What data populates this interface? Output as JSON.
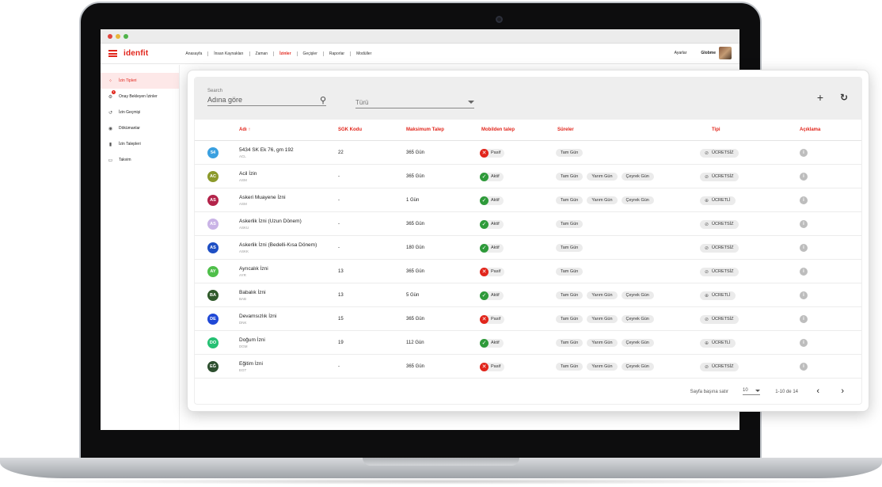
{
  "app": {
    "brand": "idenfit",
    "menu": [
      "Anasayfa",
      "İnsan Kaynakları",
      "Zaman",
      "İzinler",
      "Geçişler",
      "Raporlar",
      "Modüller"
    ],
    "active_menu_index": 3,
    "settings": "Ayarlar",
    "user": "Globme"
  },
  "sidebar": {
    "items": [
      {
        "label": "İzin Tipleri",
        "icon": "grid-icon",
        "active": true
      },
      {
        "label": "Onay Bekleyen İzinler",
        "icon": "pending-icon",
        "badge": "3"
      },
      {
        "label": "İzin Geçmişi",
        "icon": "history-icon"
      },
      {
        "label": "Dökümanlar",
        "icon": "documents-icon"
      },
      {
        "label": "İzin Talepleri",
        "icon": "requests-icon"
      },
      {
        "label": "Takvim",
        "icon": "calendar-icon"
      }
    ]
  },
  "filters": {
    "search_label": "Search",
    "search_placeholder": "Adına göre",
    "type_placeholder": "Türü"
  },
  "table": {
    "columns": {
      "name": "Adı ↑",
      "sgk": "SGK Kodu",
      "max": "Maksimum Talep",
      "mobile": "Mobilden talep",
      "durations": "Süreler",
      "type": "Tipi",
      "desc": "Açıklama"
    },
    "rows": [
      {
        "abbr": "54",
        "color": "#3aa0e0",
        "name": "5434 SK Ek 76, gm 192",
        "code": "ACL",
        "sgk": "22",
        "max": "365 Gün",
        "mobile": "Pasif",
        "active": false,
        "durations": [
          "Tam Gün"
        ],
        "type": "ÜCRETSİZ"
      },
      {
        "abbr": "AC",
        "color": "#8c9a2b",
        "name": "Acil İzin",
        "code": "ASM",
        "sgk": "-",
        "max": "365 Gün",
        "mobile": "Aktif",
        "active": true,
        "durations": [
          "Tam Gün",
          "Yarım Gün",
          "Çeyrek Gün"
        ],
        "type": "ÜCRETSİZ"
      },
      {
        "abbr": "AS",
        "color": "#b3234a",
        "name": "Askeri Muayene İzni",
        "code": "ASM",
        "sgk": "-",
        "max": "1 Gün",
        "mobile": "Aktif",
        "active": true,
        "durations": [
          "Tam Gün",
          "Yarım Gün",
          "Çeyrek Gün"
        ],
        "type": "ÜCRETLİ"
      },
      {
        "abbr": "AS",
        "color": "#c9b3e6",
        "name": "Askerlik İzni (Uzun Dönem)",
        "code": "ASKU",
        "sgk": "-",
        "max": "365 Gün",
        "mobile": "Aktif",
        "active": true,
        "durations": [
          "Tam Gün"
        ],
        "type": "ÜCRETSİZ"
      },
      {
        "abbr": "AS",
        "color": "#1e4fc4",
        "name": "Askerlik İzni (Bedelli-Kısa Dönem)",
        "code": "ASKK",
        "sgk": "-",
        "max": "180 Gün",
        "mobile": "Aktif",
        "active": true,
        "durations": [
          "Tam Gün"
        ],
        "type": "ÜCRETSİZ"
      },
      {
        "abbr": "AY",
        "color": "#4fbf4a",
        "name": "Ayrıcalık İzni",
        "code": "AYR",
        "sgk": "13",
        "max": "365 Gün",
        "mobile": "Pasif",
        "active": false,
        "durations": [
          "Tam Gün"
        ],
        "type": "ÜCRETSİZ"
      },
      {
        "abbr": "BA",
        "color": "#2f5a2a",
        "name": "Babalık İzni",
        "code": "BAB",
        "sgk": "13",
        "max": "5 Gün",
        "mobile": "Aktif",
        "active": true,
        "durations": [
          "Tam Gün",
          "Yarım Gün",
          "Çeyrek Gün"
        ],
        "type": "ÜCRETLİ"
      },
      {
        "abbr": "DE",
        "color": "#1f48d6",
        "name": "Devamsızlık İzni",
        "code": "DNK",
        "sgk": "15",
        "max": "365 Gün",
        "mobile": "Pasif",
        "active": false,
        "durations": [
          "Tam Gün",
          "Yarım Gün",
          "Çeyrek Gün"
        ],
        "type": "ÜCRETSİZ"
      },
      {
        "abbr": "DO",
        "color": "#25c073",
        "name": "Doğum İzni",
        "code": "DGM",
        "sgk": "19",
        "max": "112 Gün",
        "mobile": "Aktif",
        "active": true,
        "durations": [
          "Tam Gün",
          "Yarım Gün",
          "Çeyrek Gün"
        ],
        "type": "ÜCRETLİ"
      },
      {
        "abbr": "EĞ",
        "color": "#2d4f2f",
        "name": "Eğitim İzni",
        "code": "EGT",
        "sgk": "-",
        "max": "365 Gün",
        "mobile": "Pasif",
        "active": false,
        "durations": [
          "Tam Gün",
          "Yarım Gün",
          "Çeyrek Gün"
        ],
        "type": "ÜCRETSİZ"
      }
    ]
  },
  "pager": {
    "label": "Sayfa başına satır",
    "per_page": "10",
    "range": "1-10 de 14"
  }
}
